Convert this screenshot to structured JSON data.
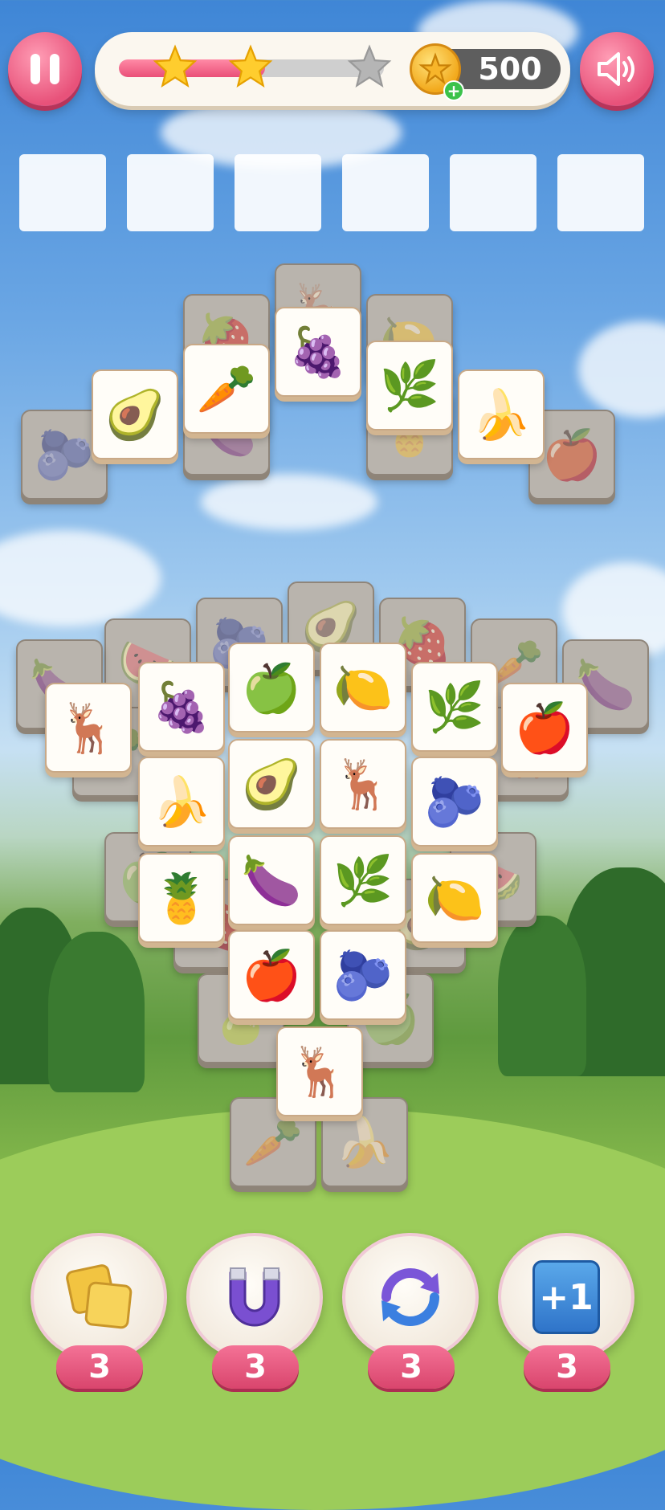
{
  "header": {
    "pause_icon": "pause-icon",
    "sound_icon": "speaker-icon",
    "progress_fraction": 0.55,
    "stars_earned": 2,
    "stars_total": 3,
    "coins": "500"
  },
  "tray": {
    "slot_count": 6
  },
  "colors": {
    "accent": "#e8527a",
    "tile_face": "#fffdf8",
    "tile_locked": "#b9b4ad",
    "coin": "#f2a91c"
  },
  "tiles": {
    "top_group": [
      {
        "icon": "🦌",
        "state": "locked"
      },
      {
        "icon": "🍓",
        "state": "locked"
      },
      {
        "icon": "🍋",
        "state": "locked"
      },
      {
        "icon": "🍇",
        "state": "open"
      },
      {
        "icon": "🥕",
        "state": "open"
      },
      {
        "icon": "🌿",
        "state": "open"
      },
      {
        "icon": "🥑",
        "state": "open"
      },
      {
        "icon": "🍌",
        "state": "open"
      },
      {
        "icon": "🫐",
        "state": "locked"
      },
      {
        "icon": "🍆",
        "state": "locked"
      },
      {
        "icon": "🍍",
        "state": "locked"
      },
      {
        "icon": "🍎",
        "state": "locked"
      }
    ],
    "bottom_group": [
      {
        "icon": "🥑",
        "state": "locked"
      },
      {
        "icon": "🫐",
        "state": "locked"
      },
      {
        "icon": "🍓",
        "state": "locked"
      },
      {
        "icon": "🍉",
        "state": "locked"
      },
      {
        "icon": "🥕",
        "state": "locked"
      },
      {
        "icon": "🍆",
        "state": "locked"
      },
      {
        "icon": "🍆",
        "state": "locked"
      },
      {
        "icon": "🍏",
        "state": "open"
      },
      {
        "icon": "🍋",
        "state": "open"
      },
      {
        "icon": "🦌",
        "state": "open"
      },
      {
        "icon": "🍇",
        "state": "open"
      },
      {
        "icon": "🌿",
        "state": "open"
      },
      {
        "icon": "🍎",
        "state": "open"
      },
      {
        "icon": "🥕",
        "state": "locked"
      },
      {
        "icon": "🦌",
        "state": "locked"
      },
      {
        "icon": "🍌",
        "state": "open"
      },
      {
        "icon": "🥑",
        "state": "open"
      },
      {
        "icon": "🦌",
        "state": "open"
      },
      {
        "icon": "🫐",
        "state": "open"
      },
      {
        "icon": "🍏",
        "state": "locked"
      },
      {
        "icon": "🍉",
        "state": "locked"
      },
      {
        "icon": "🍍",
        "state": "open"
      },
      {
        "icon": "🍆",
        "state": "open"
      },
      {
        "icon": "🌿",
        "state": "open"
      },
      {
        "icon": "🍋",
        "state": "open"
      },
      {
        "icon": "🍓",
        "state": "locked"
      },
      {
        "icon": "🥑",
        "state": "locked"
      },
      {
        "icon": "🍎",
        "state": "open"
      },
      {
        "icon": "🫐",
        "state": "open"
      },
      {
        "icon": "🍐",
        "state": "locked"
      },
      {
        "icon": "🍏",
        "state": "locked"
      },
      {
        "icon": "🦌",
        "state": "open"
      },
      {
        "icon": "🥕",
        "state": "locked"
      },
      {
        "icon": "🍌",
        "state": "locked"
      }
    ]
  },
  "boosters": [
    {
      "name": "shuffle-tiles",
      "icon": "tiles-icon",
      "count": "3"
    },
    {
      "name": "magnet",
      "icon": "magnet-icon",
      "count": "3"
    },
    {
      "name": "refresh",
      "icon": "refresh-icon",
      "count": "3"
    },
    {
      "name": "extra-slot",
      "icon": "plus-one-icon",
      "label": "+1",
      "count": "3"
    }
  ]
}
